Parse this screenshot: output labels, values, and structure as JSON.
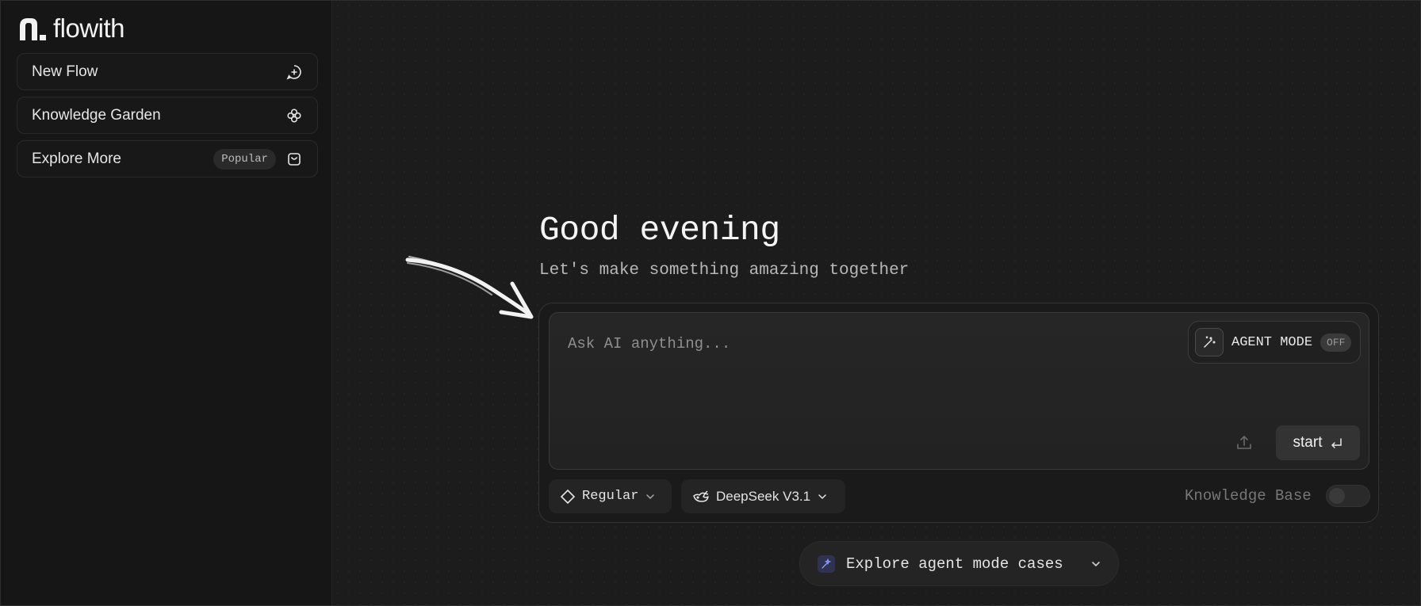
{
  "brand": {
    "name": "flowith"
  },
  "sidebar": {
    "items": [
      {
        "label": "New Flow",
        "icon": "chat-plus-icon"
      },
      {
        "label": "Knowledge Garden",
        "icon": "flower-icon"
      },
      {
        "label": "Explore More",
        "badge": "Popular",
        "icon": "shopping-bag-icon"
      }
    ]
  },
  "main": {
    "greeting": "Good evening",
    "subtitle": "Let's make something amazing together",
    "input": {
      "placeholder": "Ask AI anything...",
      "value": ""
    },
    "agent_mode": {
      "label": "AGENT MODE",
      "state": "OFF",
      "icon": "magic-wand-icon"
    },
    "upload": {
      "icon": "upload-icon"
    },
    "start": {
      "label": "start",
      "icon": "enter-key-icon"
    },
    "mode": {
      "label": "Regular",
      "icon": "diamond-icon"
    },
    "model": {
      "label": "DeepSeek V3.1",
      "icon": "whale-icon"
    },
    "knowledge_base": {
      "label": "Knowledge Base",
      "enabled": false
    },
    "explore": {
      "label": "Explore agent mode cases",
      "icon": "sparkle-icon"
    }
  },
  "colors": {
    "background": "#1c1c1c",
    "sidebar": "#161616",
    "accent": "#6b7bff"
  }
}
